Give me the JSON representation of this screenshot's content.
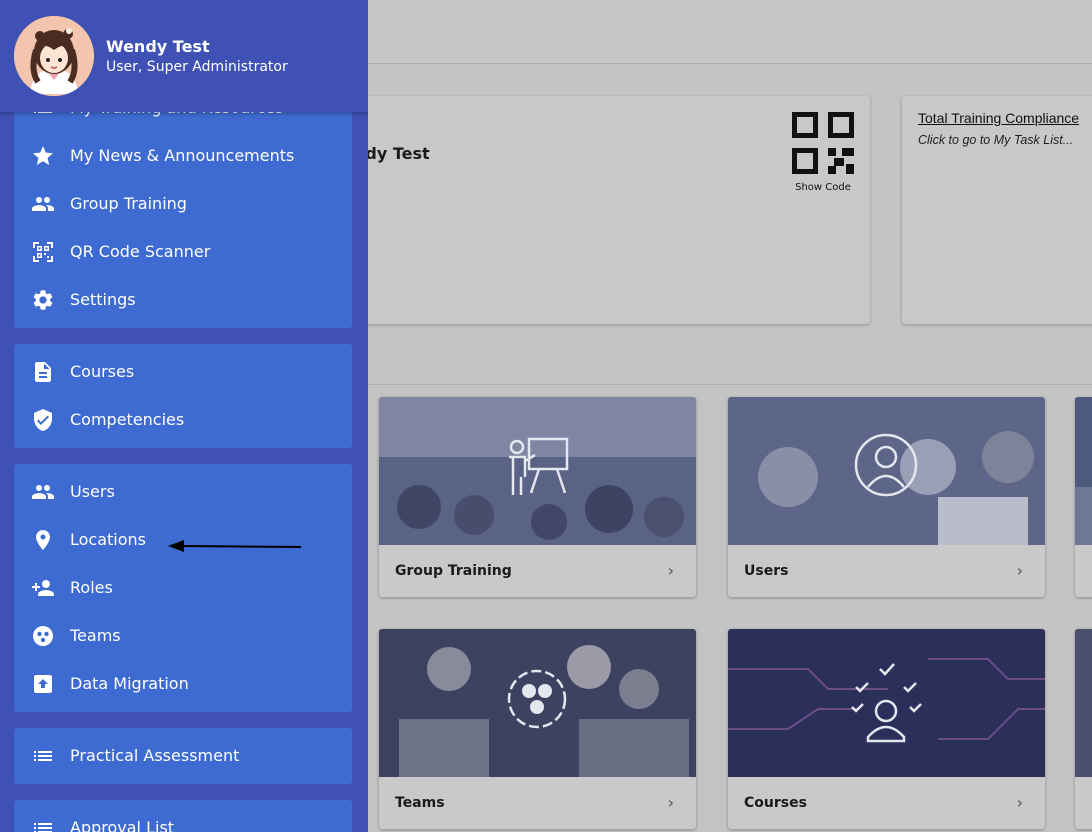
{
  "user": {
    "name": "Wendy Test",
    "role": "User, Super Administrator"
  },
  "menu": {
    "partial_top_label": "My Training and Resources",
    "group1": [
      {
        "label": "My News & Announcements",
        "icon": "star-icon"
      },
      {
        "label": "Group Training",
        "icon": "people-icon"
      },
      {
        "label": "QR Code Scanner",
        "icon": "qr-scanner-icon"
      },
      {
        "label": "Settings",
        "icon": "gear-icon"
      }
    ],
    "group2": [
      {
        "label": "Courses",
        "icon": "document-icon"
      },
      {
        "label": "Competencies",
        "icon": "shield-check-icon"
      }
    ],
    "group3": [
      {
        "label": "Users",
        "icon": "people-icon"
      },
      {
        "label": "Locations",
        "icon": "location-pin-icon"
      },
      {
        "label": "Roles",
        "icon": "person-add-icon"
      },
      {
        "label": "Teams",
        "icon": "teams-icon"
      },
      {
        "label": "Data Migration",
        "icon": "upload-box-icon"
      }
    ],
    "group4": [
      {
        "label": "Practical Assessment",
        "icon": "list-icon"
      }
    ],
    "group5": [
      {
        "label": "Approval List",
        "icon": "list-icon"
      }
    ]
  },
  "background": {
    "profile_name_partial": "ndy Test",
    "qr_label": "Show Code",
    "compliance_title": "Total Training Compliance",
    "compliance_subtitle": "Click to go to My Task List...",
    "tiles": [
      {
        "label": "Group Training"
      },
      {
        "label": "Users"
      },
      {
        "label": "Teams"
      },
      {
        "label": "Courses"
      }
    ]
  },
  "colors": {
    "drawer": "#3f51b5",
    "menu_group": "#3e6bd1",
    "overlay_bg": "#c4c4c4"
  }
}
